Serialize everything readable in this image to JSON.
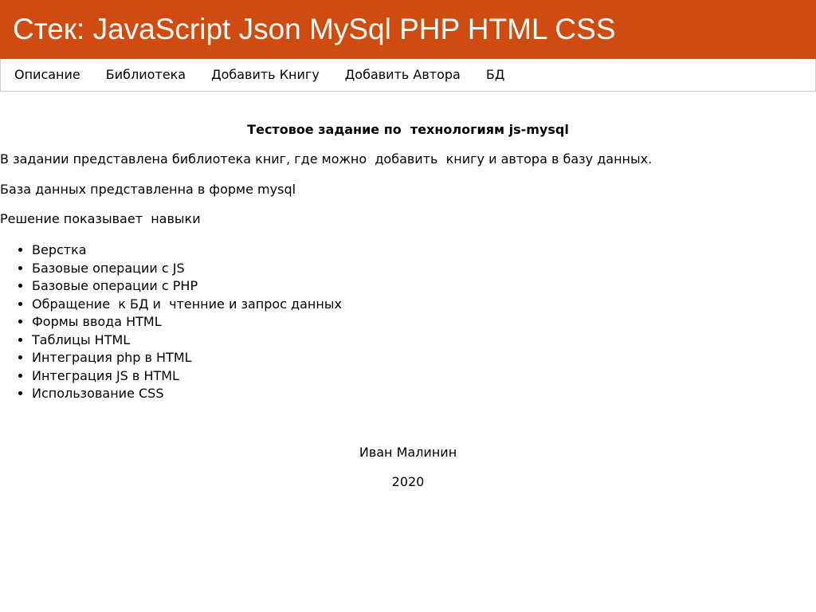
{
  "header": {
    "title": "Стек: JavaScript Json MySql PHP HTML CSS"
  },
  "nav": {
    "items": [
      {
        "label": "Описание"
      },
      {
        "label": "Библиотека"
      },
      {
        "label": "Добавить Книгу"
      },
      {
        "label": "Добавить Автора"
      },
      {
        "label": "БД"
      }
    ]
  },
  "main": {
    "heading": "Тестовое задание по  технологиям js-mysql",
    "paragraphs": [
      "В задании представлена библиотека книг, где можно  добавить  книгу и автора в базу данных.",
      "База данных представленна в форме mysql",
      "Решение показывает  навыки"
    ],
    "skills": [
      "Верстка",
      "Базовые операции с JS",
      "Базовые операции с PHP",
      "Обращение  к БД и  чтенние и запрос данных",
      "Формы ввода HTML",
      "Таблицы HTML",
      "Интеграция php в HTML",
      "Интеграция JS в HTML",
      "Использование CSS"
    ]
  },
  "footer": {
    "author": "Иван Малинин",
    "year": "2020"
  }
}
